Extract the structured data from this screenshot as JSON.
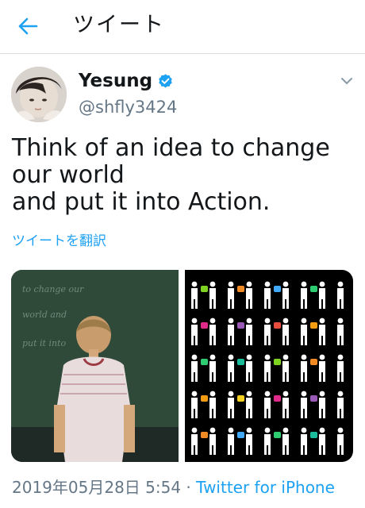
{
  "topbar": {
    "title": "ツイート",
    "back_icon": "arrow-left-icon"
  },
  "author": {
    "name": "Yesung",
    "handle": "@shfly3424",
    "verified": true
  },
  "tweet": {
    "lines": [
      "Think of an idea to change",
      "our world",
      "and put it into Action."
    ],
    "translate_label": "ツイートを翻訳"
  },
  "media": {
    "left_chalk_text": [
      "to change our",
      "world  and",
      "put it into"
    ]
  },
  "meta": {
    "timestamp": "2019年05月28日 5:54",
    "separator": " · ",
    "source": "Twitter for iPhone"
  },
  "colors": {
    "accent": "#1da1f2",
    "text": "#14171a",
    "secondary": "#657786"
  }
}
